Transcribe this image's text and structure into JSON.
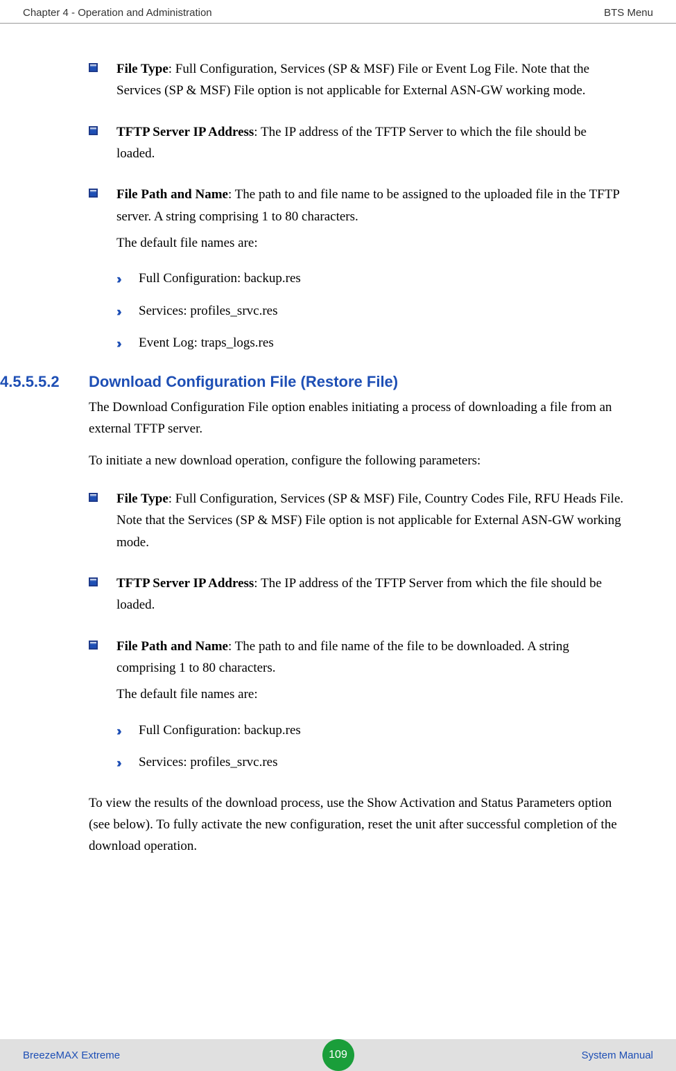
{
  "header": {
    "left": "Chapter 4 - Operation and Administration",
    "right": "BTS Menu"
  },
  "section1": {
    "bullets": [
      {
        "bold": "File Type",
        "text": ": Full Configuration, Services (SP & MSF) File or Event Log File. Note that the Services (SP & MSF) File option is not applicable for External ASN-GW working mode."
      },
      {
        "bold": "TFTP Server IP Address",
        "text": ": The IP address of the TFTP Server to which the file should be loaded."
      },
      {
        "bold": "File Path and Name",
        "text": ": The path to and file name to be assigned to the uploaded file in the TFTP server. A string comprising 1 to 80 characters."
      }
    ],
    "defaults_intro": "The default file names are:",
    "defaults": [
      "Full Configuration: backup.res",
      "Services: profiles_srvc.res",
      "Event Log: traps_logs.res"
    ]
  },
  "section2": {
    "number": "4.5.5.5.2",
    "title": "Download Configuration File (Restore File)",
    "para1": "The Download Configuration File option enables initiating a process of downloading a file from an external TFTP server.",
    "para2": "To initiate a new download operation, configure the following parameters:",
    "bullets": [
      {
        "bold": "File Type",
        "text": ": Full Configuration, Services (SP & MSF) File, Country Codes File, RFU Heads File. Note that the Services (SP & MSF) File option is not applicable for External ASN-GW working mode."
      },
      {
        "bold": "TFTP Server IP Address",
        "text": ": The IP address of the TFTP Server from which the file should be loaded."
      },
      {
        "bold": "File Path and Name",
        "text": ": The path to and file name of the file to be downloaded. A string comprising 1 to 80 characters."
      }
    ],
    "defaults_intro": "The default file names are:",
    "defaults": [
      "Full Configuration: backup.res",
      "Services: profiles_srvc.res"
    ],
    "para3": "To view the results of the download process, use the Show Activation and Status Parameters option (see below). To fully activate the new configuration, reset the unit after successful completion of the download operation."
  },
  "footer": {
    "left": "BreezeMAX Extreme",
    "page": "109",
    "right": "System Manual"
  }
}
